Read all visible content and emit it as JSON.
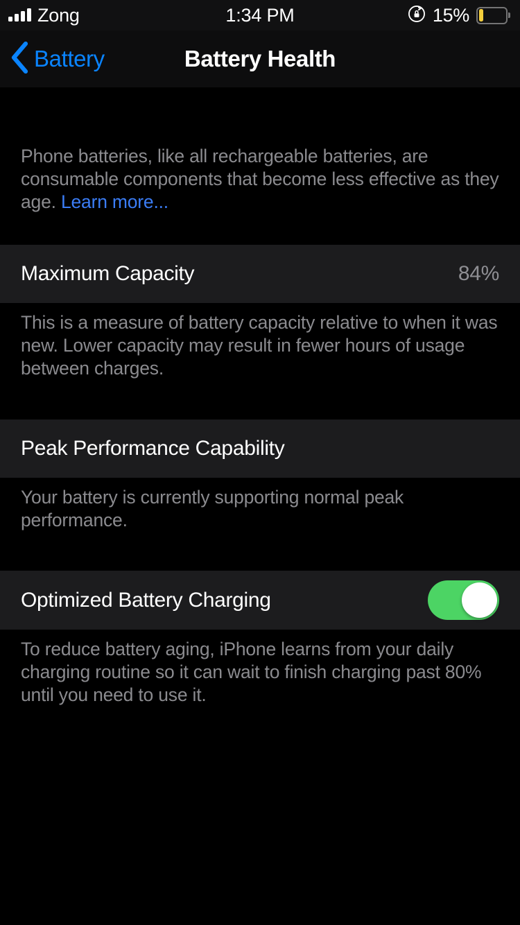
{
  "status_bar": {
    "carrier": "Zong",
    "signal_icon": "signal-bars-icon",
    "signal_bars_filled": 4,
    "signal_bars_total": 4,
    "time": "1:34 PM",
    "rotation_lock_icon": "rotation-lock-icon",
    "battery_percent_label": "15%",
    "battery_level": 15,
    "battery_fill_color": "#f5cf3c",
    "battery_icon": "battery-icon"
  },
  "nav": {
    "back_icon": "chevron-left-icon",
    "back_label": "Battery",
    "title": "Battery Health",
    "back_tint_color": "#0a84ff"
  },
  "intro": {
    "text_before_link": "Phone batteries, like all rechargeable batteries, are consumable components that become less effective as they age. ",
    "link_label": "Learn more...",
    "link_color": "#3b7df6"
  },
  "maximum_capacity": {
    "title": "Maximum Capacity",
    "value": "84%",
    "footnote": "This is a measure of battery capacity relative to when it was new. Lower capacity may result in fewer hours of usage between charges."
  },
  "peak_performance": {
    "title": "Peak Performance Capability",
    "footnote": "Your battery is currently supporting normal peak performance."
  },
  "optimized_charging": {
    "title": "Optimized Battery Charging",
    "toggle_state": "on",
    "toggle_on_color": "#4cd464",
    "footnote": "To reduce battery aging, iPhone learns from your daily charging routine so it can wait to finish charging past 80% until you need to use it."
  }
}
